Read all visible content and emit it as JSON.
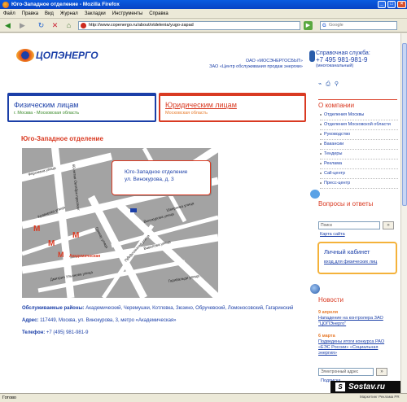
{
  "window": {
    "title": "Юго-Западное отделение - Mozilla Firefox"
  },
  "menu": [
    "Файл",
    "Правка",
    "Вид",
    "Журнал",
    "Закладки",
    "Инструменты",
    "Справка"
  ],
  "nav": {
    "url": "http://www.copenergo.ru/about/otdelenia/yugo-zapad",
    "search_placeholder": "Google"
  },
  "header": {
    "logo_text": "ЦОПЭНЕРГО",
    "company_line1": "ОАО «МОСЭНЕРГОСБЫТ»",
    "company_line2": "ЗАО «Центр обслуживания продаж энергии»",
    "hotline_label": "Справочная служба:",
    "hotline_number": "+7 495 981-981-9",
    "hotline_note": "(многоканальный)"
  },
  "tabs": {
    "individuals_title": "Физическим лицам",
    "individuals_sub": "г. Москва - Московская область",
    "legal_title": "Юридическим лицам",
    "legal_sub": "Московская область"
  },
  "main": {
    "section_title": "Юго-Западное отделение",
    "callout_line1": "Юго-Западное отделение",
    "callout_line2": "ул. Винокурова, д. 3",
    "metro_label": "Академическая",
    "areas_label": "Обслуживаемые районы:",
    "areas_text": "Академический, Черемушки, Котловка, Зюзино, Обручевский, Ломоносовский, Гагаринский",
    "address_label": "Адрес:",
    "address_text": "117449, Москва, ул. Винокурова, 3, метро «Академическая»",
    "phone_label": "Телефон:",
    "phone_text": "+7 (495) 981-981-9",
    "streets": [
      "Ферсмана улица",
      "60-летия Октября проспект",
      "Гримау улица",
      "Кравченко улица",
      "Профсоюзная улица",
      "Вавилова улица",
      "Шверника улица",
      "Винокурова улица",
      "Дмитрия Ульянова улица",
      "Гарибальди улица"
    ]
  },
  "sidebar": {
    "about_title": "О компании",
    "about_items": [
      "Отделения Москвы",
      "Отделения Московской области",
      "Руководство",
      "Вакансии",
      "Тендеры",
      "Реклама",
      "Call-центр",
      "Пресс-центр"
    ],
    "qa_title": "Вопросы и ответы",
    "search_placeholder": "Поиск",
    "search_go": "»",
    "sitemap": "Карта сайта",
    "cabinet_title": "Личный кабинет",
    "cabinet_link": "вход для физических лиц",
    "news_title": "Новости",
    "news": [
      {
        "date": "9 апреля",
        "text": "Нападение на контролера ЗАО \"ЦОПЭнерго\""
      },
      {
        "date": "6 марта",
        "text": "Подведены итоги конкурса РАО «ЕЭС России» «Социальная энергия»"
      }
    ],
    "email_placeholder": "Электронный адрес",
    "email_go": "»",
    "subscribe": "Подписка"
  },
  "watermark": {
    "brand": "Sostav.ru",
    "caption": "Маркетинг Реклама PR"
  },
  "status": {
    "text": "Готово"
  }
}
